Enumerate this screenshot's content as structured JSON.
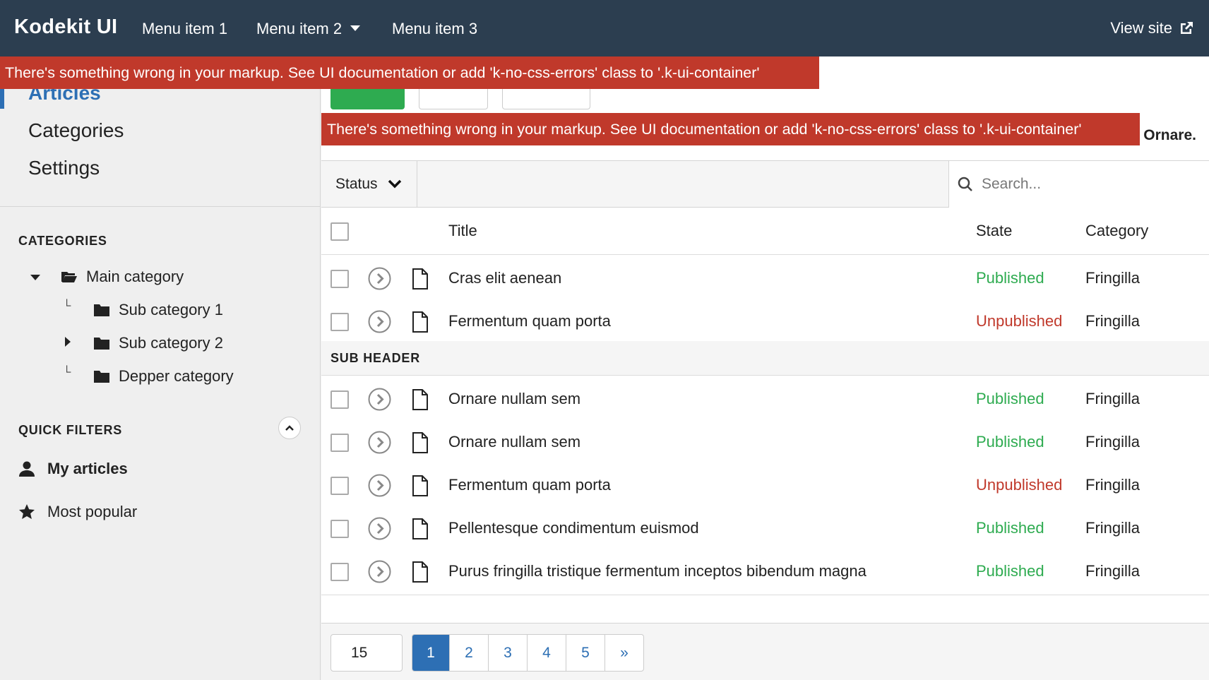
{
  "navbar": {
    "brand": "Kodekit UI",
    "items": [
      {
        "label": "Menu item 1"
      },
      {
        "label": "Menu item 2"
      },
      {
        "label": "Menu item 3"
      }
    ],
    "view_site": "View site"
  },
  "errors": {
    "message": "There's something wrong in your markup. See UI documentation or add 'k-no-css-errors' class to '.k-ui-container'"
  },
  "sidebar": {
    "nav": [
      {
        "label": "Articles",
        "active": true
      },
      {
        "label": "Categories"
      },
      {
        "label": "Settings"
      }
    ],
    "categories_heading": "CATEGORIES",
    "tree": [
      {
        "label": "Main category"
      },
      {
        "label": "Sub category 1"
      },
      {
        "label": "Sub category 2"
      },
      {
        "label": "Depper category"
      }
    ],
    "quick_filters_heading": "QUICK FILTERS",
    "filters": [
      {
        "label": "My articles",
        "icon": "user-icon"
      },
      {
        "label": "Most popular",
        "icon": "star-icon"
      }
    ]
  },
  "main": {
    "ornare_text": "Ornare.",
    "status_filter": "Status",
    "search_placeholder": "Search...",
    "columns": {
      "title": "Title",
      "state": "State",
      "category": "Category"
    },
    "rows_top": [
      {
        "title": "Cras elit aenean",
        "state": "Published",
        "category": "Fringilla"
      },
      {
        "title": "Fermentum quam porta",
        "state": "Unpublished",
        "category": "Fringilla"
      }
    ],
    "subheader": "SUB HEADER",
    "rows_bottom": [
      {
        "title": "Ornare nullam sem",
        "state": "Published",
        "category": "Fringilla"
      },
      {
        "title": "Ornare nullam sem",
        "state": "Published",
        "category": "Fringilla"
      },
      {
        "title": "Fermentum quam porta",
        "state": "Unpublished",
        "category": "Fringilla"
      },
      {
        "title": "Pellentesque condimentum euismod",
        "state": "Published",
        "category": "Fringilla"
      },
      {
        "title": "Purus fringilla tristique fermentum inceptos bibendum magna",
        "state": "Published",
        "category": "Fringilla"
      }
    ],
    "limit": "15",
    "pages": [
      "1",
      "2",
      "3",
      "4",
      "5",
      "»"
    ],
    "active_page": "1"
  },
  "colors": {
    "navbar_bg": "#2c3e50",
    "error_bg": "#c0392b",
    "published": "#2eab50",
    "unpublished": "#c0392b",
    "accent": "#2d6fb4"
  }
}
